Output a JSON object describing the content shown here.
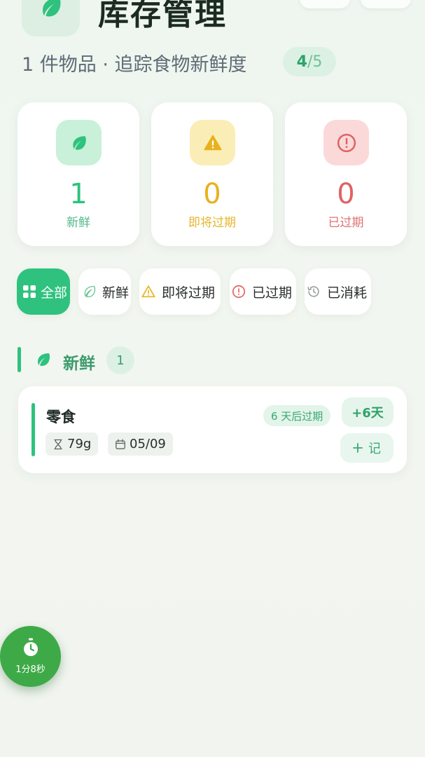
{
  "header": {
    "title": "库存管理",
    "subtitle": "1 件物品 · 追踪食物新鲜度",
    "progress": {
      "current": "4",
      "separator": "/",
      "total": "5"
    }
  },
  "stats": [
    {
      "value": "1",
      "label": "新鲜",
      "icon": "leaf-icon",
      "color": "#2ec27e"
    },
    {
      "value": "0",
      "label": "即将过期",
      "icon": "warning-icon",
      "color": "#e8b21c"
    },
    {
      "value": "0",
      "label": "已过期",
      "icon": "alert-circle-icon",
      "color": "#e06262"
    }
  ],
  "filters": [
    {
      "label": "全部",
      "icon": "grid-icon",
      "active": true
    },
    {
      "label": "新鲜",
      "icon": "leaf-outline-icon",
      "active": false
    },
    {
      "label": "即将过期",
      "icon": "warning-outline-icon",
      "active": false
    },
    {
      "label": "已过期",
      "icon": "alert-circle-outline-icon",
      "active": false
    },
    {
      "label": "已消耗",
      "icon": "history-icon",
      "active": false
    }
  ],
  "section": {
    "title": "新鲜",
    "count": "1"
  },
  "items": [
    {
      "name": "零食",
      "weight": "79g",
      "date": "05/09",
      "expiry": "6 天后过期",
      "extend_label": "+6天",
      "log_label": "记"
    }
  ],
  "timer": {
    "label": "1分8秒"
  },
  "colors": {
    "accent": "#2ec27e",
    "warning": "#e8b21c",
    "danger": "#e06262",
    "fab": "#3daa47"
  }
}
